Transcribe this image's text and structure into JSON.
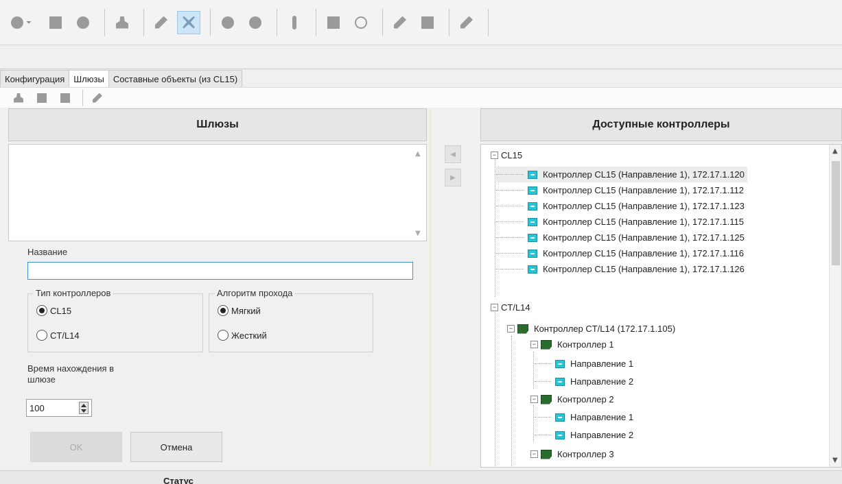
{
  "tabs": [
    {
      "label": "Конфигурация",
      "active": false
    },
    {
      "label": "Шлюзы",
      "active": true
    },
    {
      "label": "Составные объекты (из CL15)",
      "active": false
    }
  ],
  "left": {
    "header": "Шлюзы",
    "name_label": "Название",
    "name_value": "",
    "controller_type": {
      "title": "Тип контроллеров",
      "options": [
        {
          "label": "CL15",
          "checked": true
        },
        {
          "label": "CT/L14",
          "checked": false
        }
      ]
    },
    "pass_algorithm": {
      "title": "Алгоритм прохода",
      "options": [
        {
          "label": "Мягкий",
          "checked": true
        },
        {
          "label": "Жесткий",
          "checked": false
        }
      ]
    },
    "time_label_line1": "Время нахождения в",
    "time_label_line2": "шлюзе",
    "time_value": "100",
    "ok_label": "OK",
    "cancel_label": "Отмена"
  },
  "right": {
    "header": "Доступные контроллеры",
    "tree": [
      {
        "label": "CL15",
        "kind": "group"
      },
      {
        "label": "Контроллер CL15 (Направление 1), 172.17.1.120",
        "kind": "direction",
        "selected": true
      },
      {
        "label": "Контроллер CL15 (Направление 1), 172.17.1.112",
        "kind": "direction"
      },
      {
        "label": "Контроллер CL15 (Направление 1), 172.17.1.123",
        "kind": "direction"
      },
      {
        "label": "Контроллер CL15 (Направление 1), 172.17.1.115",
        "kind": "direction"
      },
      {
        "label": "Контроллер CL15 (Направление 1), 172.17.1.125",
        "kind": "direction"
      },
      {
        "label": "Контроллер CL15 (Направление 1), 172.17.1.116",
        "kind": "direction"
      },
      {
        "label": "Контроллер CL15 (Направление 1), 172.17.1.126",
        "kind": "direction"
      },
      {
        "label": "CT/L14",
        "kind": "group"
      },
      {
        "label": "Контроллер CT/L14 (172.17.1.105)",
        "kind": "controller"
      },
      {
        "label": "Контроллер 1",
        "kind": "controller"
      },
      {
        "label": "Направление 1",
        "kind": "direction"
      },
      {
        "label": "Направление 2",
        "kind": "direction"
      },
      {
        "label": "Контроллер 2",
        "kind": "controller"
      },
      {
        "label": "Направление 1",
        "kind": "direction"
      },
      {
        "label": "Направление 2",
        "kind": "direction"
      },
      {
        "label": "Контроллер 3",
        "kind": "controller"
      }
    ]
  },
  "status": {
    "label": "Статус"
  },
  "colors": {
    "accent": "#3c8fd9",
    "direction_icon": "#27c4d6",
    "controller_icon": "#2c6b2e",
    "active_tool": "#cde6f7"
  },
  "icons": {
    "toolbar_top": [
      "add-icon",
      "dropdown-arrow-icon",
      "save-icon",
      "tag-icon",
      "user-icon",
      "edit-icon",
      "delete-icon",
      "record-icon",
      "search-icon",
      "exclamation-icon",
      "export-icon",
      "refresh-icon",
      "pen-icon",
      "grid-icon",
      "plug-icon"
    ],
    "toolbar_second": [
      "user-icon",
      "list-icon",
      "table-icon",
      "edit-icon"
    ]
  }
}
